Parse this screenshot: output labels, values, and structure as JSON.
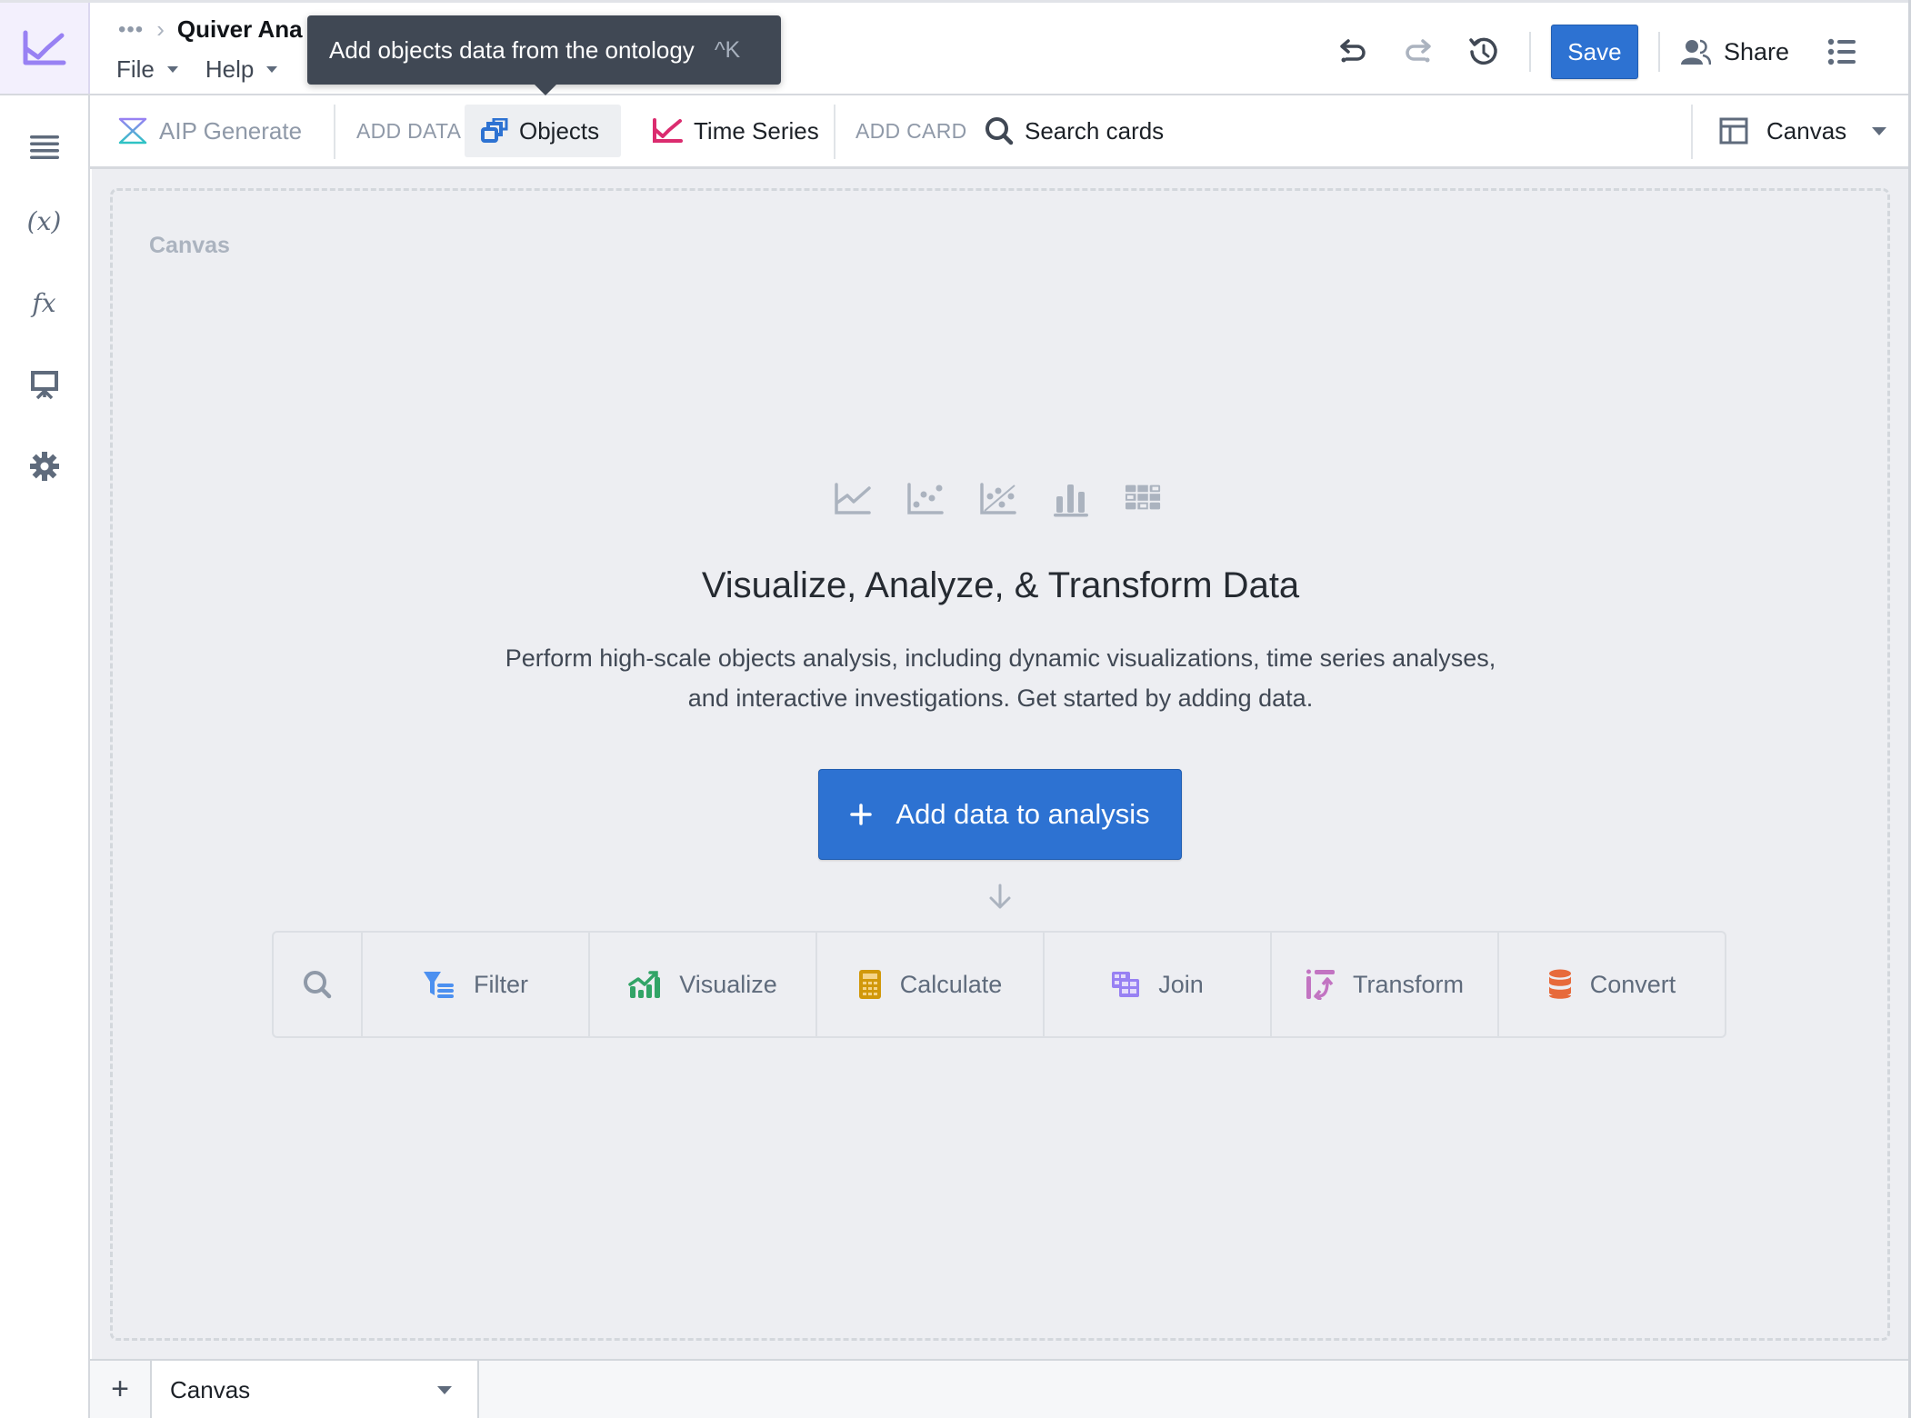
{
  "header": {
    "breadcrumb_overflow": "•••",
    "breadcrumb_separator": "›",
    "title": "Quiver Ana",
    "menus": [
      {
        "label": "File"
      },
      {
        "label": "Help"
      }
    ],
    "save_label": "Save",
    "share_label": "Share",
    "icons": [
      "undo-icon",
      "redo-icon",
      "history-icon",
      "share-people-icon",
      "list-menu-icon"
    ]
  },
  "tooltip": {
    "text": "Add objects data from the ontology",
    "shortcut": "^K"
  },
  "sidebar": {
    "items": [
      {
        "name": "outline",
        "icon": "hamburger-list-icon"
      },
      {
        "name": "variables",
        "icon": "variable-x-icon",
        "glyph": "(x)"
      },
      {
        "name": "functions",
        "icon": "function-fx-icon",
        "glyph": "fx"
      },
      {
        "name": "presentation",
        "icon": "presentation-icon"
      },
      {
        "name": "settings",
        "icon": "gear-icon"
      }
    ]
  },
  "toolbar": {
    "aip_generate": "AIP Generate",
    "add_data_label": "ADD DATA",
    "objects": "Objects",
    "time_series": "Time Series",
    "add_card_label": "ADD CARD",
    "search_cards": "Search cards",
    "layout_select": "Canvas"
  },
  "canvas": {
    "label": "Canvas",
    "viz_icons": [
      "line-chart-icon",
      "scatter-plot-icon",
      "regression-plot-icon",
      "bar-chart-icon",
      "pivot-table-icon"
    ],
    "headline": "Visualize, Analyze, & Transform Data",
    "subtext_line1": "Perform high-scale objects analysis, including dynamic visualizations, time series analyses,",
    "subtext_line2": "and interactive investigations. Get started by adding data.",
    "add_button": "Add data to analysis",
    "actions": [
      {
        "label": "Filter",
        "icon": "filter-icon",
        "color": "#4c90f0"
      },
      {
        "label": "Visualize",
        "icon": "chart-growth-icon",
        "color": "#32a467"
      },
      {
        "label": "Calculate",
        "icon": "calculator-icon",
        "color": "#d1980b"
      },
      {
        "label": "Join",
        "icon": "join-table-icon",
        "color": "#9881f3"
      },
      {
        "label": "Transform",
        "icon": "transform-icon",
        "color": "#c274c2"
      },
      {
        "label": "Convert",
        "icon": "database-icon",
        "color": "#e76a3b"
      }
    ]
  },
  "bottom_bar": {
    "add_tab": "+",
    "active_tab": "Canvas"
  },
  "colors": {
    "primary": "#2d72d2",
    "logo": "#9881f3",
    "time_series": "#db2c6f",
    "canvas_bg": "#edeef2"
  }
}
